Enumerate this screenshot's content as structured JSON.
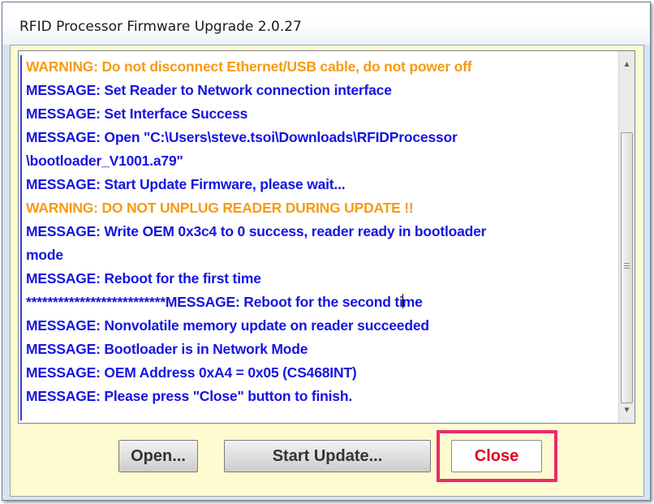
{
  "window": {
    "title": "RFID Processor Firmware Upgrade 2.0.27"
  },
  "log": {
    "lines": [
      {
        "type": "warning",
        "text": "WARNING: Do not disconnect Ethernet/USB cable, do not power off"
      },
      {
        "type": "message",
        "text": "MESSAGE: Set Reader to Network connection interface"
      },
      {
        "type": "message",
        "text": "MESSAGE: Set Interface Success"
      },
      {
        "type": "message",
        "text": "MESSAGE: Open \"C:\\Users\\steve.tsoi\\Downloads\\RFIDProcessor"
      },
      {
        "type": "message",
        "text": "\\bootloader_V1001.a79\""
      },
      {
        "type": "message",
        "text": "MESSAGE: Start Update Firmware, please wait..."
      },
      {
        "type": "warning",
        "text": "WARNING: DO NOT UNPLUG READER DURING UPDATE !!"
      },
      {
        "type": "message",
        "text": "MESSAGE: Write OEM 0x3c4 to 0 success, reader ready in bootloader"
      },
      {
        "type": "message",
        "text": "mode"
      },
      {
        "type": "message",
        "text": "MESSAGE: Reboot for the first time"
      },
      {
        "type": "message",
        "text": "**************************MESSAGE: Reboot for the second time"
      },
      {
        "type": "message",
        "text": "MESSAGE: Nonvolatile memory update on reader succeeded"
      },
      {
        "type": "message",
        "text": "MESSAGE: Bootloader is in Network Mode"
      },
      {
        "type": "message",
        "text": "MESSAGE: OEM Address 0xA4 = 0x05 (CS468INT)"
      },
      {
        "type": "message",
        "text": "MESSAGE: Please press \"Close\" button to finish."
      }
    ],
    "colors": {
      "message": "#1515e0",
      "warning": "#f79a11"
    }
  },
  "scrollbar": {
    "up_icon": "scroll-up-arrow",
    "down_icon": "scroll-down-arrow"
  },
  "buttons": {
    "open_label": "Open...",
    "start_update_label": "Start Update...",
    "close_label": "Close"
  },
  "highlight": {
    "color": "#ea2a6c"
  }
}
